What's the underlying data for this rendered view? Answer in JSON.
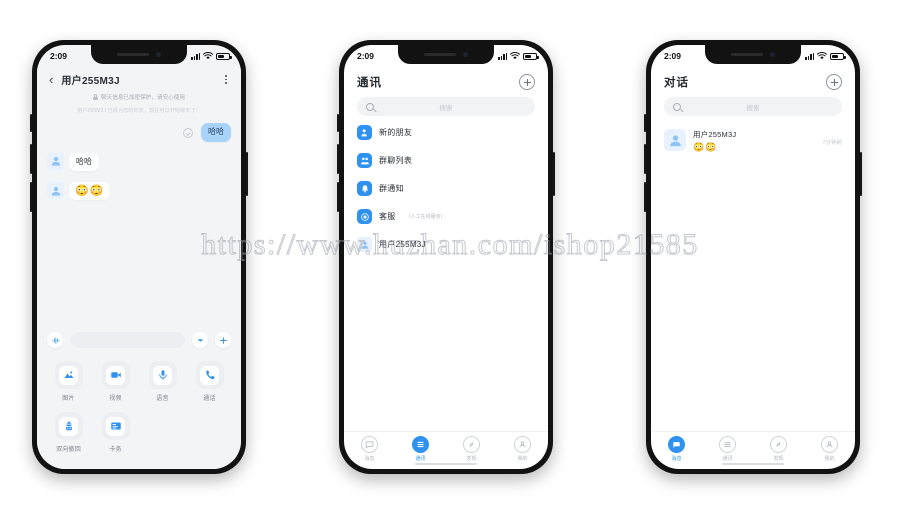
{
  "watermark": "https://www.huzhan.com/ishop21585",
  "status_bar": {
    "time": "2:09"
  },
  "colors": {
    "accent": "#2f92f0",
    "bubble_out": "#a8d4fb",
    "chat_bg": "#f3f4f6"
  },
  "phone1": {
    "header": {
      "back_label": "‹",
      "title": "用户255M3J",
      "menu_label": "more-menu"
    },
    "secure_notice": "聊天信息已加密保护，请安心使用",
    "system_message": "用户255M3J 已成为您的好友，现在可以开始聊天了！",
    "messages": [
      {
        "side": "right",
        "type": "text",
        "text": "哈哈"
      },
      {
        "side": "left",
        "type": "text",
        "text": "哈哈"
      },
      {
        "side": "left",
        "type": "emoji",
        "text": "😳😳"
      }
    ],
    "input_bar": {
      "voice_icon": "voice-wave-icon",
      "placeholder": "",
      "emoji_icon": "emoji-icon",
      "plus_icon": "plus-icon"
    },
    "functions": [
      {
        "label": "图片",
        "icon": "image-icon"
      },
      {
        "label": "视频",
        "icon": "video-icon"
      },
      {
        "label": "语音",
        "icon": "microphone-icon"
      },
      {
        "label": "通话",
        "icon": "phone-icon"
      },
      {
        "label": "双向撤回",
        "icon": "recall-icon"
      },
      {
        "label": "卡务",
        "icon": "card-icon"
      }
    ]
  },
  "phone2": {
    "title": "通讯",
    "add_icon": "plus-circle-icon",
    "search_placeholder": "搜索",
    "items": [
      {
        "label": "新的朋友",
        "sub": "",
        "icon": "new-friend-icon",
        "color": "#2f92f0"
      },
      {
        "label": "群聊列表",
        "sub": "",
        "icon": "group-list-icon",
        "color": "#2f92f0"
      },
      {
        "label": "群通知",
        "sub": "",
        "icon": "bell-icon",
        "color": "#2f92f0"
      },
      {
        "label": "客服",
        "sub": "（人工在线服务）",
        "icon": "headset-icon",
        "color": "#2f92f0"
      }
    ],
    "contact": {
      "name": "用户255M3J",
      "icon": "user-avatar-icon"
    },
    "tabs": [
      {
        "label": "消息",
        "icon": "message-icon",
        "active": false
      },
      {
        "label": "通讯",
        "icon": "contacts-icon",
        "active": true
      },
      {
        "label": "发现",
        "icon": "compass-icon",
        "active": false
      },
      {
        "label": "我的",
        "icon": "person-icon",
        "active": false
      }
    ]
  },
  "phone3": {
    "title": "对话",
    "add_icon": "plus-circle-icon",
    "search_placeholder": "搜索",
    "conversations": [
      {
        "name": "用户255M3J",
        "preview": "😳😳",
        "time": "7分钟前",
        "avatar": "user-avatar-icon"
      }
    ],
    "tabs": [
      {
        "label": "消息",
        "icon": "message-icon",
        "active": true
      },
      {
        "label": "通讯",
        "icon": "contacts-icon",
        "active": false
      },
      {
        "label": "发现",
        "icon": "compass-icon",
        "active": false
      },
      {
        "label": "我的",
        "icon": "person-icon",
        "active": false
      }
    ]
  }
}
